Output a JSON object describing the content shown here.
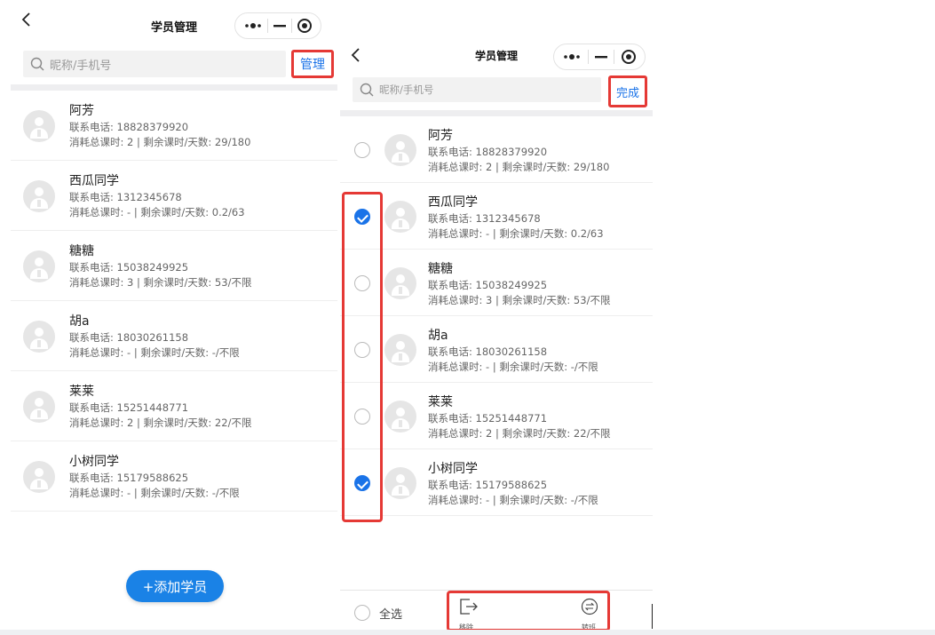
{
  "left": {
    "title": "学员管理",
    "search_placeholder": "昵称/手机号",
    "manage_label": "管理",
    "add_button_label": "+添加学员"
  },
  "right": {
    "title": "学员管理",
    "search_placeholder": "昵称/手机号",
    "done_label": "完成",
    "select_all_label": "全选",
    "action_remove_label": "移除",
    "action_transfer_label": "转班"
  },
  "students": [
    {
      "name": "阿芳",
      "phone": "联系电话: 18828379920",
      "hours": "消耗总课时: 2 | 剩余课时/天数: 29/180",
      "selected": false
    },
    {
      "name": "西瓜同学",
      "phone": "联系电话: 1312345678",
      "hours": "消耗总课时: - | 剩余课时/天数: 0.2/63",
      "selected": true
    },
    {
      "name": "糖糖",
      "phone": "联系电话: 15038249925",
      "hours": "消耗总课时: 3 | 剩余课时/天数: 53/不限",
      "selected": false
    },
    {
      "name": "胡a",
      "phone": "联系电话: 18030261158",
      "hours": "消耗总课时: - | 剩余课时/天数: -/不限",
      "selected": false
    },
    {
      "name": "莱莱",
      "phone": "联系电话: 15251448771",
      "hours": "消耗总课时: 2 | 剩余课时/天数: 22/不限",
      "selected": false
    },
    {
      "name": "小树同学",
      "phone": "联系电话: 15179588625",
      "hours": "消耗总课时: - | 剩余课时/天数: -/不限",
      "selected": true
    }
  ],
  "colors": {
    "accent": "#1a73e8",
    "highlight": "#e53935",
    "add_button": "#1a82e6"
  },
  "icons": [
    "back-icon",
    "more-dots-icon",
    "minimize-icon",
    "close-target-icon",
    "search-icon",
    "avatar-icon",
    "remove-exit-icon",
    "transfer-icon"
  ]
}
